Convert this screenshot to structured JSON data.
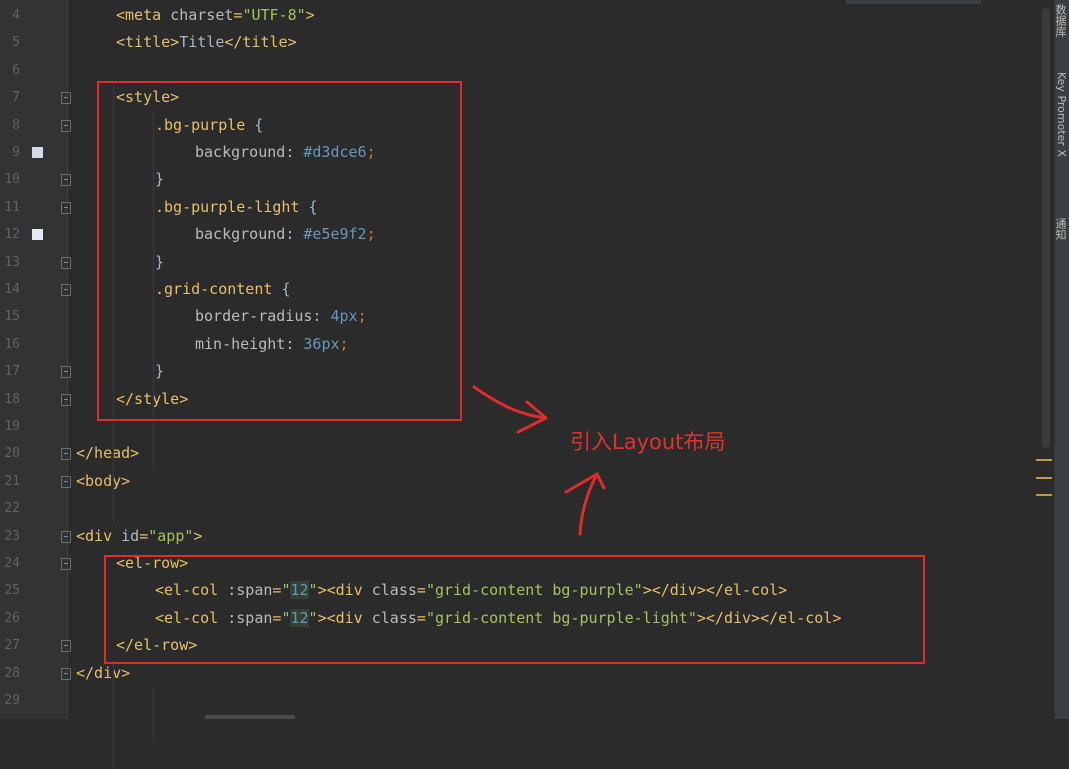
{
  "lines": [
    {
      "n": "4",
      "parts": [
        [
          "tag",
          "<meta "
        ],
        [
          "attr",
          "charset"
        ],
        [
          "tag",
          "="
        ],
        [
          "str",
          "\"UTF-8\""
        ],
        [
          "tag",
          ">"
        ]
      ],
      "indent": 116
    },
    {
      "n": "5",
      "parts": [
        [
          "tag",
          "<title>"
        ],
        [
          "txt",
          "Title"
        ],
        [
          "tag",
          "</title>"
        ]
      ],
      "indent": 116
    },
    {
      "n": "6",
      "parts": [],
      "indent": 116
    },
    {
      "n": "7",
      "parts": [
        [
          "tag",
          "<style>"
        ]
      ],
      "indent": 116
    },
    {
      "n": "8",
      "parts": [
        [
          "css-sel",
          ".bg-purple "
        ],
        [
          "txt",
          "{"
        ]
      ],
      "indent": 155
    },
    {
      "n": "9",
      "parts": [
        [
          "prop",
          "background"
        ],
        [
          "txt",
          ": "
        ],
        [
          "num",
          "#d3dce6"
        ],
        [
          "punct",
          ";"
        ]
      ],
      "indent": 195
    },
    {
      "n": "10",
      "parts": [
        [
          "txt",
          "}"
        ]
      ],
      "indent": 155
    },
    {
      "n": "11",
      "parts": [
        [
          "css-sel",
          ".bg-purple-light "
        ],
        [
          "txt",
          "{"
        ]
      ],
      "indent": 155
    },
    {
      "n": "12",
      "parts": [
        [
          "prop",
          "background"
        ],
        [
          "txt",
          ": "
        ],
        [
          "num",
          "#e5e9f2"
        ],
        [
          "punct",
          ";"
        ]
      ],
      "indent": 195
    },
    {
      "n": "13",
      "parts": [
        [
          "txt",
          "}"
        ]
      ],
      "indent": 155
    },
    {
      "n": "14",
      "parts": [
        [
          "css-sel",
          ".grid-content "
        ],
        [
          "txt",
          "{"
        ]
      ],
      "indent": 155
    },
    {
      "n": "15",
      "parts": [
        [
          "prop",
          "border-radius"
        ],
        [
          "txt",
          ": "
        ],
        [
          "num",
          "4"
        ],
        [
          "num",
          "px"
        ],
        [
          "punct",
          ";"
        ]
      ],
      "indent": 195
    },
    {
      "n": "16",
      "parts": [
        [
          "prop",
          "min-height"
        ],
        [
          "txt",
          ": "
        ],
        [
          "num",
          "36"
        ],
        [
          "num",
          "px"
        ],
        [
          "punct",
          ";"
        ]
      ],
      "indent": 195
    },
    {
      "n": "17",
      "parts": [
        [
          "txt",
          "}"
        ]
      ],
      "indent": 155
    },
    {
      "n": "18",
      "parts": [
        [
          "tag",
          "</style>"
        ]
      ],
      "indent": 116
    },
    {
      "n": "19",
      "parts": [],
      "indent": 116
    },
    {
      "n": "20",
      "parts": [
        [
          "tag",
          "</head>"
        ]
      ],
      "indent": 76
    },
    {
      "n": "21",
      "parts": [
        [
          "tag",
          "<body>"
        ]
      ],
      "indent": 76
    },
    {
      "n": "22",
      "parts": [],
      "indent": 76
    },
    {
      "n": "23",
      "parts": [
        [
          "tag",
          "<div "
        ],
        [
          "attr",
          "id"
        ],
        [
          "tag",
          "="
        ],
        [
          "str",
          "\"app\""
        ],
        [
          "tag",
          ">"
        ]
      ],
      "indent": 76
    },
    {
      "n": "24",
      "parts": [
        [
          "tag",
          "<el-row>"
        ]
      ],
      "indent": 116
    },
    {
      "n": "25",
      "parts": [
        [
          "tag",
          "<el-col "
        ],
        [
          "attr",
          ":span"
        ],
        [
          "tag",
          "="
        ],
        [
          "str",
          "\""
        ],
        [
          "hlnum",
          "12"
        ],
        [
          "str",
          "\""
        ],
        [
          "tag",
          "><div "
        ],
        [
          "attr",
          "class"
        ],
        [
          "tag",
          "="
        ],
        [
          "str",
          "\"grid-content bg-purple\""
        ],
        [
          "tag",
          "></div></el-col>"
        ]
      ],
      "indent": 155
    },
    {
      "n": "26",
      "parts": [
        [
          "tag",
          "<el-col "
        ],
        [
          "attr",
          ":span"
        ],
        [
          "tag",
          "="
        ],
        [
          "str",
          "\""
        ],
        [
          "hlnum",
          "12"
        ],
        [
          "str",
          "\""
        ],
        [
          "tag",
          "><div "
        ],
        [
          "attr",
          "class"
        ],
        [
          "tag",
          "="
        ],
        [
          "str",
          "\"grid-content bg-purple-light\""
        ],
        [
          "tag",
          "></div></el-col>"
        ]
      ],
      "indent": 155
    },
    {
      "n": "27",
      "parts": [
        [
          "tag",
          "</el-row>"
        ]
      ],
      "indent": 116
    },
    {
      "n": "28",
      "parts": [
        [
          "tag",
          "</div>"
        ]
      ],
      "indent": 76
    },
    {
      "n": "29",
      "parts": [],
      "indent": 76
    }
  ],
  "annotation": "引入Layout布局",
  "right_tool_tabs": [
    "数据库",
    "Key Promoter X",
    "通知"
  ],
  "colors": {
    "annotation_red": "#e02b2b",
    "color_marker_1": "#d3dce6",
    "color_marker_2": "#e5e9f2"
  }
}
